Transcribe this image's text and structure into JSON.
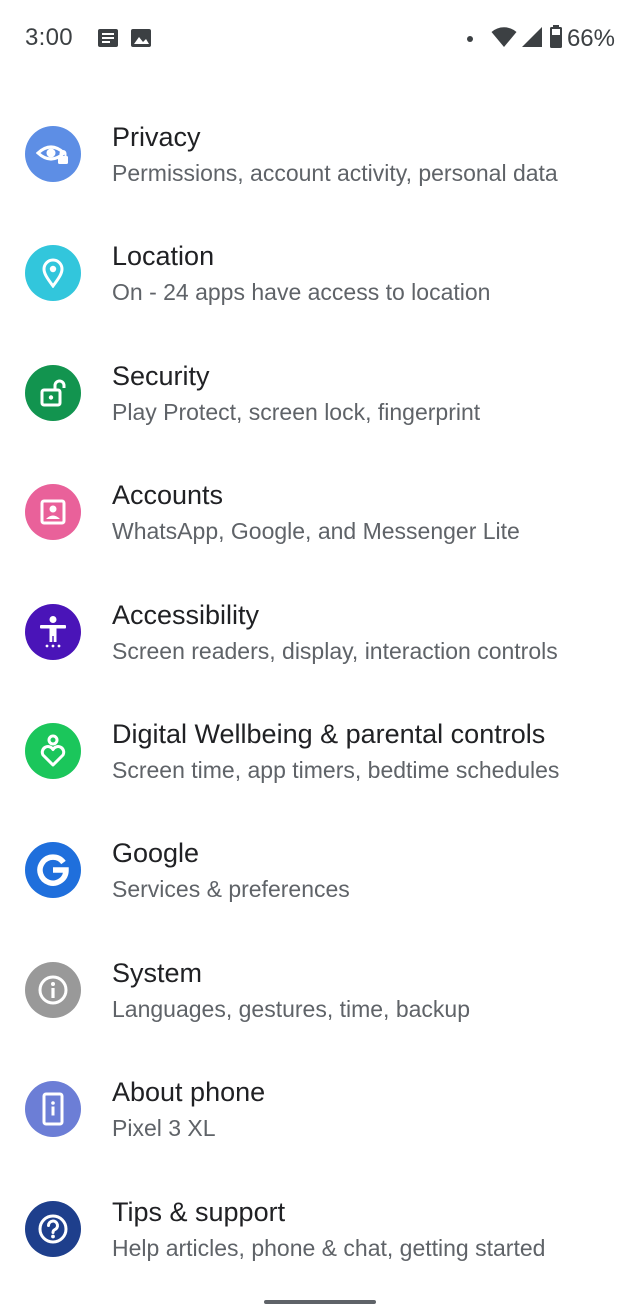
{
  "status_bar": {
    "time": "3:00",
    "battery": "66%",
    "notification_icons": [
      "message-notification-icon",
      "image-notification-icon"
    ],
    "system_icons": [
      "notification-dot-icon",
      "wifi-icon",
      "cellular-signal-icon",
      "battery-icon"
    ]
  },
  "settings": {
    "items": [
      {
        "title": "Privacy",
        "subtitle": "Permissions, account activity, personal data",
        "icon": "privacy-eye-icon",
        "color": "#5d8ee5"
      },
      {
        "title": "Location",
        "subtitle": "On - 24 apps have access to location",
        "icon": "location-pin-icon",
        "color": "#32c6dc"
      },
      {
        "title": "Security",
        "subtitle": "Play Protect, screen lock, fingerprint",
        "icon": "unlock-icon",
        "color": "#12944f"
      },
      {
        "title": "Accounts",
        "subtitle": "WhatsApp, Google, and Messenger Lite",
        "icon": "account-box-icon",
        "color": "#e9619a"
      },
      {
        "title": "Accessibility",
        "subtitle": "Screen readers, display, interaction controls",
        "icon": "accessibility-person-icon",
        "color": "#4a14b8"
      },
      {
        "title": "Digital Wellbeing & parental controls",
        "subtitle": "Screen time, app timers, bedtime schedules",
        "icon": "wellbeing-heart-icon",
        "color": "#1bc65b"
      },
      {
        "title": "Google",
        "subtitle": "Services & preferences",
        "icon": "google-g-icon",
        "color": "#1f6fdc"
      },
      {
        "title": "System",
        "subtitle": "Languages, gestures, time, backup",
        "icon": "info-icon",
        "color": "#999999"
      },
      {
        "title": "About phone",
        "subtitle": "Pixel 3 XL",
        "icon": "phone-info-icon",
        "color": "#6c7ed6"
      },
      {
        "title": "Tips & support",
        "subtitle": "Help articles, phone & chat, getting started",
        "icon": "help-question-icon",
        "color": "#1e3f8c"
      }
    ]
  }
}
